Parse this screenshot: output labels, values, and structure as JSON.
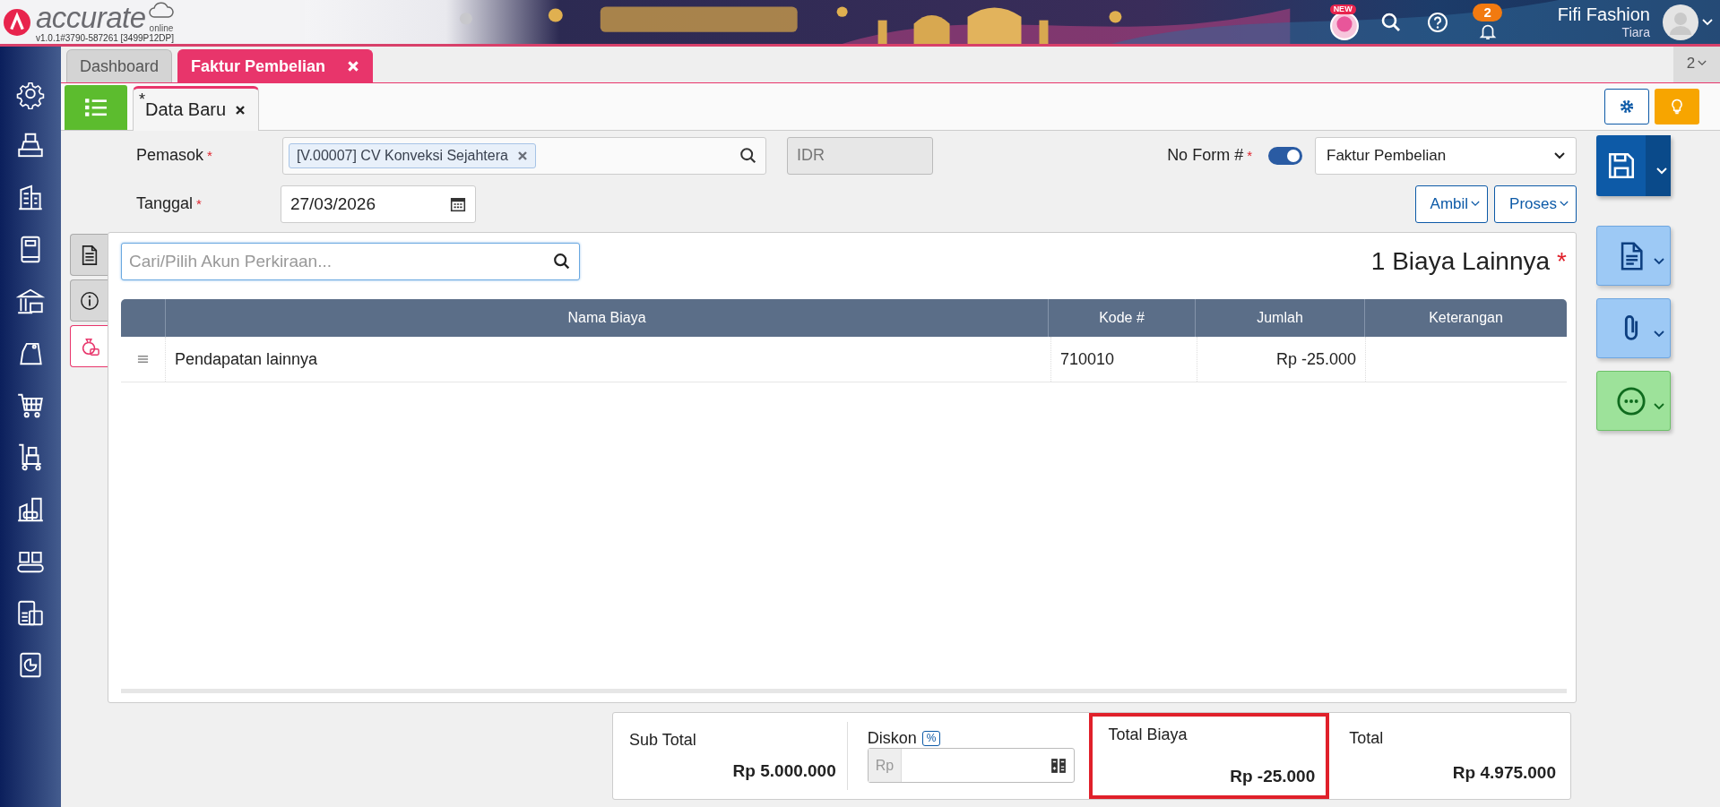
{
  "header": {
    "logo": "accurate",
    "logo_sub": "online",
    "version": "v1.0.1#3790-587261 [3499P12DP]",
    "new_badge": "NEW",
    "notifications": "2",
    "company": "Fifi Fashion",
    "user": "Tiara"
  },
  "tabs": [
    {
      "label": "Dashboard",
      "selected": false,
      "closable": false
    },
    {
      "label": "Faktur Pembelian",
      "selected": true,
      "closable": true
    }
  ],
  "tab_count": "2",
  "doc_tab": {
    "mark": "*",
    "label": "Data Baru"
  },
  "form": {
    "supplier_label": "Pemasok",
    "supplier_required": true,
    "supplier": "[V.00007] CV Konveksi Sejahtera",
    "currency": "IDR",
    "form_no_label": "No Form #",
    "form_no_required": true,
    "auto_number": true,
    "form_type": "Faktur Pembelian",
    "date_label": "Tanggal",
    "date_required": true,
    "date": "27/03/2026"
  },
  "buttons": [
    "Ambil",
    "Proses"
  ],
  "side_tabs": [
    {
      "kind": "document",
      "selected": false
    },
    {
      "kind": "info",
      "selected": false
    },
    {
      "kind": "expense",
      "selected": true
    }
  ],
  "search": {
    "placeholder": "Cari/Pilih Akun Perkiraan..."
  },
  "section": {
    "title": "1 Biaya Lainnya",
    "required": true
  },
  "table": {
    "columns": [
      "Nama Biaya",
      "Kode #",
      "Jumlah",
      "Keterangan"
    ],
    "rows": [
      {
        "nama": "Pendapatan lainnya",
        "kode": "710010",
        "jumlah": "Rp -25.000"
      }
    ]
  },
  "summary": {
    "sub_total": {
      "label": "Sub Total",
      "value": "Rp 5.000.000"
    },
    "discount": {
      "label": "Diskon",
      "badge": "%",
      "prefix": "Rp"
    },
    "total_cost": {
      "label": "Total Biaya",
      "value": "Rp -25.000",
      "highlighted": true
    },
    "total": {
      "label": "Total",
      "value": "Rp 4.975.000"
    }
  }
}
